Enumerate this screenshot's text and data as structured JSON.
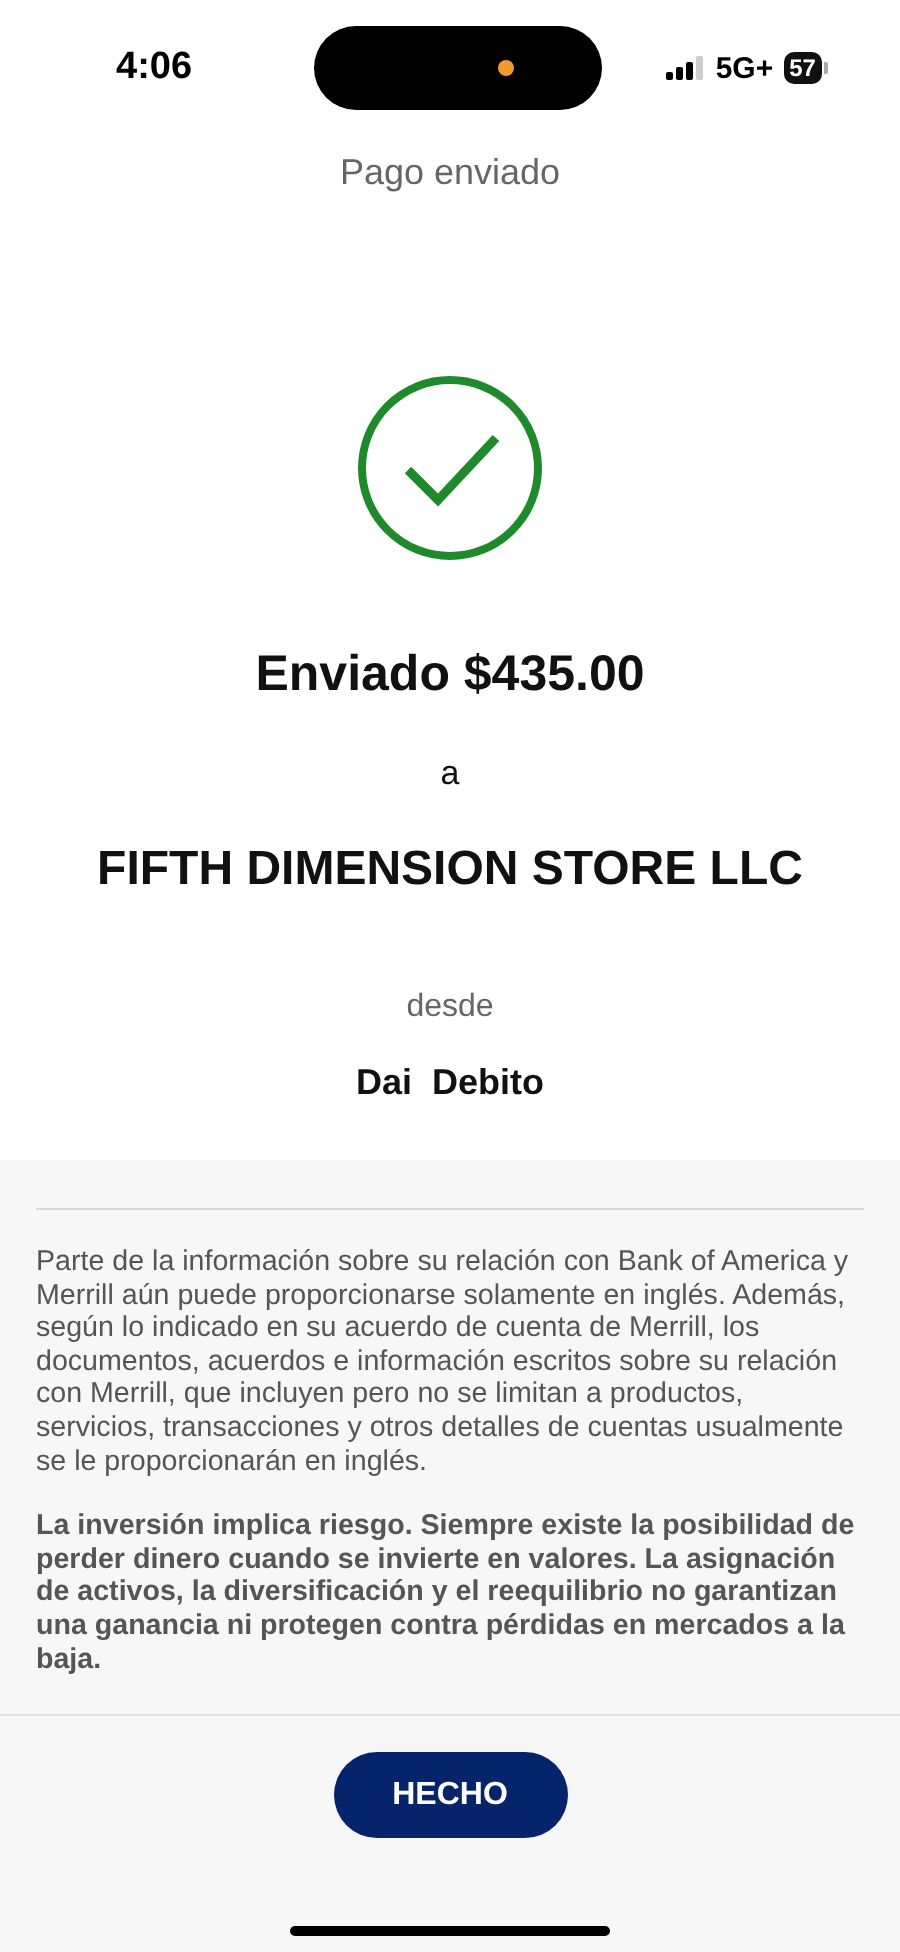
{
  "status_bar": {
    "time": "4:06",
    "network": "5G+",
    "battery": "57"
  },
  "header": {
    "title": "Pago enviado"
  },
  "confirmation": {
    "amount_line": "Enviado $435.00",
    "connector": "a",
    "recipient": "FIFTH DIMENSION STORE LLC",
    "from_label": "desde",
    "account": "Dai  Debito"
  },
  "disclosures": [
    {
      "kind": "plain",
      "text": "Parte de la información sobre su relación con Bank of America y Merrill aún puede proporcionarse solamente en inglés. Además, según lo indicado en su acuerdo de cuenta de Merrill, los documentos, acuerdos e información escritos sobre su relación con Merrill, que incluyen pero no se limitan a productos, servicios, transacciones y otros detalles de cuentas usualmente se le proporcionarán en inglés."
    },
    {
      "kind": "bold",
      "text": "La inversión implica riesgo. Siempre existe la posibilidad de perder dinero cuando se invierte en valores. La asignación de activos, la diversificación y el reequilibrio no garantizan una ganancia ni protegen contra pérdidas en mercados a la baja."
    }
  ],
  "footer": {
    "button": "HECHO"
  }
}
